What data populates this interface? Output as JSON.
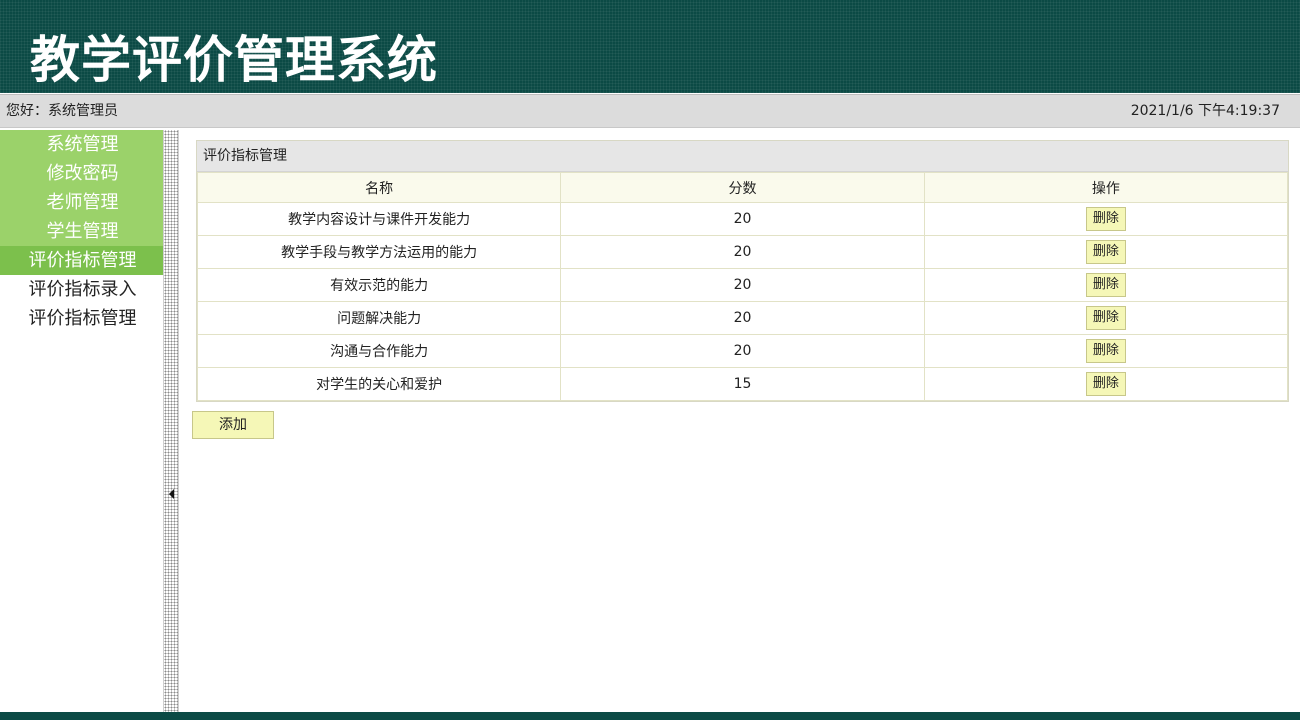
{
  "app": {
    "title": "教学评价管理系统"
  },
  "infobar": {
    "greeting": "您好：系统管理员",
    "datetime": "2021/1/6 下午4:19:37"
  },
  "sidebar": {
    "groups": [
      {
        "label": "系统管理"
      },
      {
        "label": "修改密码"
      },
      {
        "label": "老师管理"
      },
      {
        "label": "学生管理"
      },
      {
        "label": "评价指标管理"
      }
    ],
    "sub_items": [
      {
        "label": "评价指标录入"
      },
      {
        "label": "评价指标管理"
      }
    ]
  },
  "panel": {
    "title": "评价指标管理",
    "columns": [
      "名称",
      "分数",
      "操作"
    ],
    "rows": [
      {
        "name": "教学内容设计与课件开发能力",
        "score": "20",
        "action": "删除"
      },
      {
        "name": "教学手段与教学方法运用的能力",
        "score": "20",
        "action": "删除"
      },
      {
        "name": "有效示范的能力",
        "score": "20",
        "action": "删除"
      },
      {
        "name": "问题解决能力",
        "score": "20",
        "action": "删除"
      },
      {
        "name": "沟通与合作能力",
        "score": "20",
        "action": "删除"
      },
      {
        "name": "对学生的关心和爱护",
        "score": "15",
        "action": "删除"
      }
    ]
  },
  "actions": {
    "add_label": "添加"
  },
  "colors": {
    "header_bg": "#0b4a45",
    "sidebar_green": "#9bd26a",
    "button_yellow": "#f5f7b7"
  }
}
